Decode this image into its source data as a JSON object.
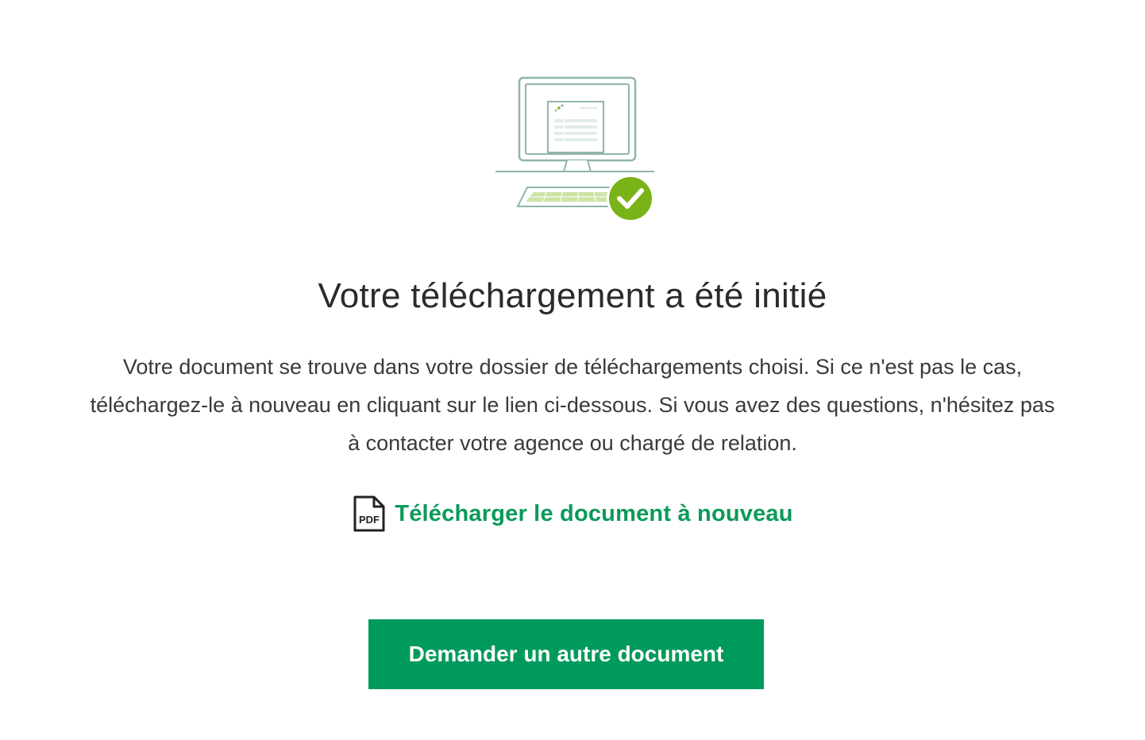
{
  "illustration": {
    "monitor_icon": "computer-monitor-icon",
    "check_icon": "success-check-icon"
  },
  "title": "Votre téléchargement a été initié",
  "message": {
    "line1": "Votre document se trouve dans votre dossier de téléchargements choisi. Si ce n'est pas le cas,",
    "line2": "téléchargez-le à nouveau en cliquant sur le lien ci-dessous. Si vous avez des questions, n'hésitez pas",
    "line3": "à contacter votre agence ou chargé de relation."
  },
  "redownload": {
    "icon": "pdf-file-icon",
    "icon_text": "PDF",
    "label": "Télécharger le document à nouveau"
  },
  "primary_button": {
    "label": "Demander un autre document"
  },
  "colors": {
    "accent_green": "#009a5c",
    "link_green": "#0a9a5a",
    "check_green": "#7ab317",
    "outline_teal": "#8fb5ac"
  }
}
